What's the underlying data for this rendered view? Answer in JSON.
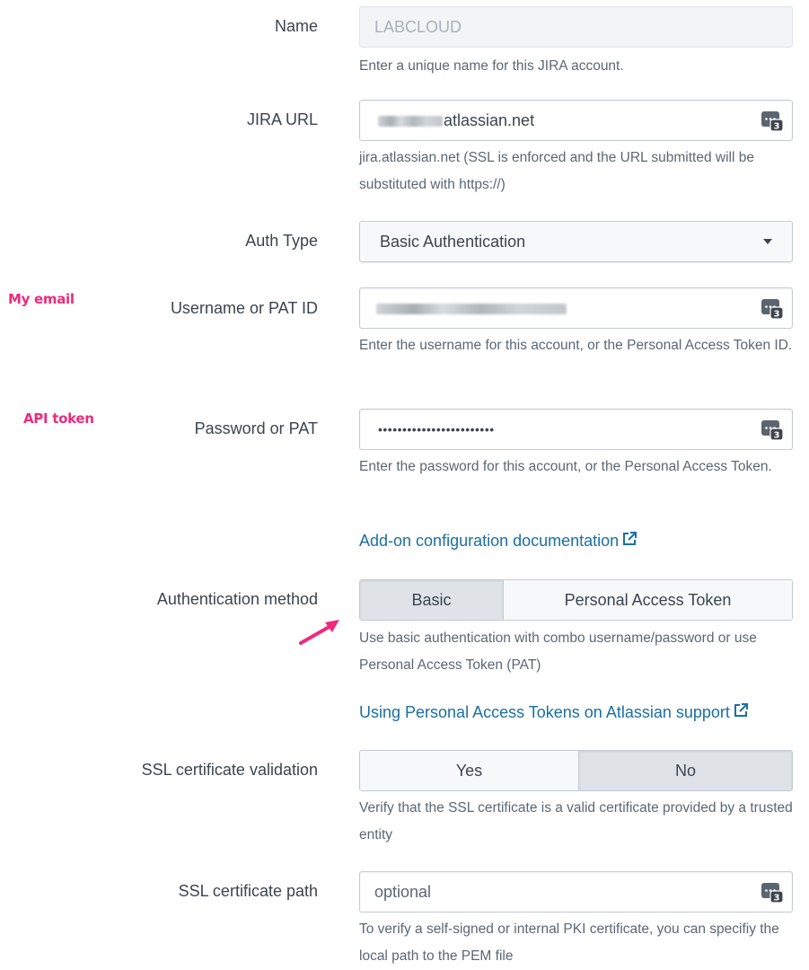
{
  "name": {
    "label": "Name",
    "value": "LABCLOUD",
    "help": "Enter a unique name for this JIRA account."
  },
  "jira_url": {
    "label": "JIRA URL",
    "value_suffix": "atlassian.net",
    "help": "jira.atlassian.net (SSL is enforced and the URL submitted will be substituted with https://)"
  },
  "auth_type": {
    "label": "Auth Type",
    "selected": "Basic Authentication"
  },
  "username": {
    "label": "Username or PAT ID",
    "help": "Enter the username for this account, or the Personal Access Token ID."
  },
  "password": {
    "label": "Password or PAT",
    "value": "••••••••••••••••••••••••",
    "help": "Enter the password for this account, or the Personal Access Token."
  },
  "doc_link": "Add-on configuration documentation",
  "auth_method": {
    "label": "Authentication method",
    "options": [
      "Basic",
      "Personal Access Token"
    ],
    "selected": "Basic",
    "help": "Use basic authentication with combo username/password or use Personal Access Token (PAT)"
  },
  "pat_link": "Using Personal Access Tokens on Atlassian support",
  "ssl_validation": {
    "label": "SSL certificate validation",
    "options": [
      "Yes",
      "No"
    ],
    "selected": "No",
    "help": "Verify that the SSL certificate is a valid certificate provided by a trusted entity"
  },
  "ssl_path": {
    "label": "SSL certificate path",
    "placeholder": "optional",
    "help": "To verify a self-signed or internal PKI certificate, you can specifiy the local path to the PEM file"
  },
  "annotations": {
    "email": "My email",
    "token": "API token"
  },
  "password_manager_badge": "3",
  "colors": {
    "link": "#1a6fa3",
    "annotation": "#ee2a7b",
    "active_segment": "#dfe3e8"
  }
}
